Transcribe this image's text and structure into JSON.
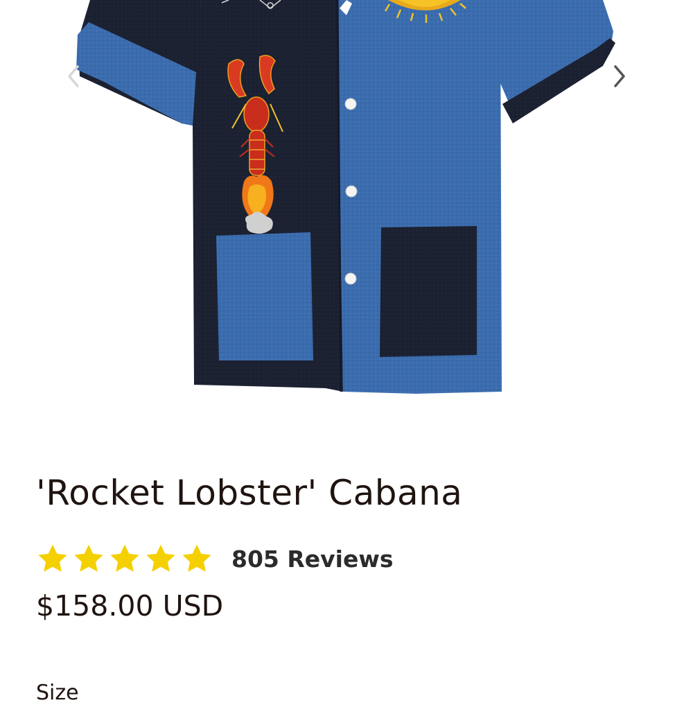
{
  "gallery": {
    "prev_icon": "chevron-left-icon",
    "next_icon": "chevron-right-icon",
    "image_alt": "'Rocket Lobster' Cabana shirt"
  },
  "product": {
    "title": "'Rocket Lobster' Cabana",
    "rating": 5,
    "rating_max": 5,
    "review_count_label": "805 Reviews",
    "price": "$158.00 USD",
    "size_label": "Size"
  },
  "colors": {
    "star": "#f5d000",
    "text": "#1f1410",
    "navy_fabric": "#1c2233",
    "blue_fabric": "#3d6fb0"
  }
}
